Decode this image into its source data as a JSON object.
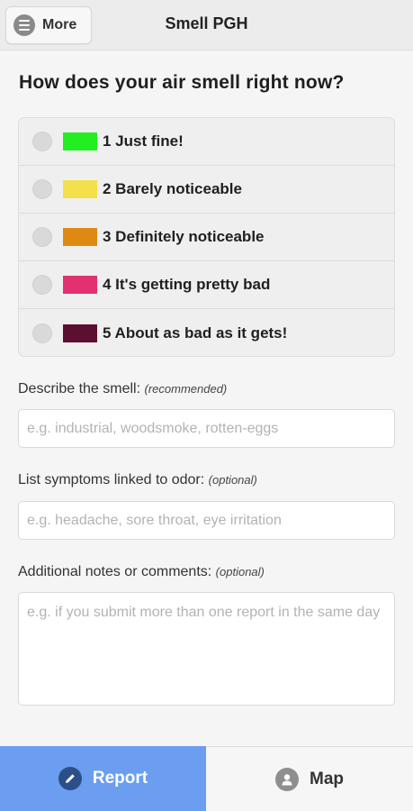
{
  "header": {
    "title": "Smell PGH",
    "more_label": "More"
  },
  "question": "How does your air smell right now?",
  "options": [
    {
      "label": "1 Just fine!",
      "color": "#22ee22"
    },
    {
      "label": "2 Barely noticeable",
      "color": "#f3e04a"
    },
    {
      "label": "3 Definitely noticeable",
      "color": "#de8a12"
    },
    {
      "label": "4 It's getting pretty bad",
      "color": "#e23070"
    },
    {
      "label": "5 About as bad as it gets!",
      "color": "#5c0f30"
    }
  ],
  "fields": {
    "describe": {
      "label": "Describe the smell:",
      "note": "(recommended)",
      "placeholder": "e.g. industrial, woodsmoke, rotten-eggs"
    },
    "symptoms": {
      "label": "List symptoms linked to odor:",
      "note": "(optional)",
      "placeholder": "e.g. headache, sore throat, eye irritation"
    },
    "notes": {
      "label": "Additional notes or comments:",
      "note": "(optional)",
      "placeholder": "e.g. if you submit more than one report in the same day"
    }
  },
  "tabs": {
    "report": {
      "label": "Report",
      "icon": "pencil-icon",
      "color": "#6b9ef0"
    },
    "map": {
      "label": "Map",
      "icon": "person-icon"
    }
  }
}
